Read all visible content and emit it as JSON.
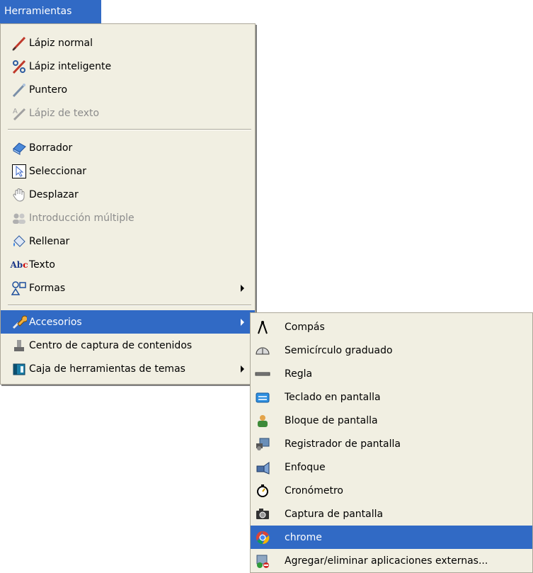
{
  "menubar": {
    "title": "Herramientas"
  },
  "main_menu": {
    "items": [
      {
        "label": "Lápiz normal",
        "icon": "pen-icon",
        "disabled": false
      },
      {
        "label": "Lápiz inteligente",
        "icon": "smart-pen-icon",
        "disabled": false
      },
      {
        "label": "Puntero",
        "icon": "pointer-icon",
        "disabled": false
      },
      {
        "label": "Lápiz de texto",
        "icon": "text-pen-icon",
        "disabled": true
      },
      {
        "label": "Borrador",
        "icon": "eraser-icon",
        "disabled": false
      },
      {
        "label": "Seleccionar",
        "icon": "select-arrow-icon",
        "disabled": false
      },
      {
        "label": "Desplazar",
        "icon": "hand-icon",
        "disabled": false
      },
      {
        "label": "Introducción múltiple",
        "icon": "multi-input-icon",
        "disabled": true
      },
      {
        "label": "Rellenar",
        "icon": "fill-bucket-icon",
        "disabled": false
      },
      {
        "label": "Texto",
        "icon": "abc-text-icon",
        "disabled": false
      },
      {
        "label": "Formas",
        "icon": "shapes-icon",
        "disabled": false,
        "submenu": true
      },
      {
        "label": "Accesorios",
        "icon": "accessories-icon",
        "disabled": false,
        "submenu": true,
        "highlighted": true
      },
      {
        "label": "Centro de captura de contenidos",
        "icon": "capture-center-icon",
        "disabled": false
      },
      {
        "label": "Caja de herramientas de temas",
        "icon": "toolbox-icon",
        "disabled": false,
        "submenu": true
      }
    ]
  },
  "sub_menu": {
    "items": [
      {
        "label": "Compás",
        "icon": "compass-icon"
      },
      {
        "label": "Semicírculo graduado",
        "icon": "protractor-icon"
      },
      {
        "label": "Regla",
        "icon": "ruler-icon"
      },
      {
        "label": "Teclado en pantalla",
        "icon": "keyboard-icon"
      },
      {
        "label": "Bloque de pantalla",
        "icon": "screen-block-icon"
      },
      {
        "label": "Registrador de pantalla",
        "icon": "screen-recorder-icon"
      },
      {
        "label": "Enfoque",
        "icon": "spotlight-icon"
      },
      {
        "label": "Cronómetro",
        "icon": "stopwatch-icon"
      },
      {
        "label": "Captura de pantalla",
        "icon": "camera-icon"
      },
      {
        "label": "chrome",
        "icon": "chrome-icon",
        "highlighted": true
      },
      {
        "label": "Agregar/eliminar aplicaciones externas...",
        "icon": "add-remove-apps-icon"
      }
    ]
  },
  "colors": {
    "highlight": "#316ac5",
    "menu_bg": "#f1efe2",
    "disabled_text": "#8b8b8b"
  }
}
